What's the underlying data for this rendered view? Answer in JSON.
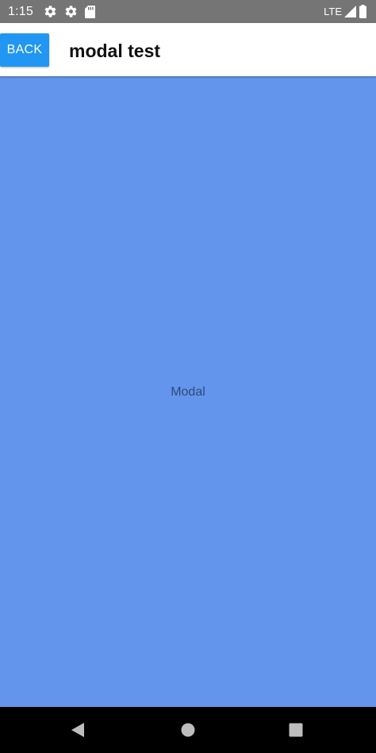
{
  "status_bar": {
    "time": "1:15",
    "network": "LTE",
    "icons": [
      "settings-icon",
      "settings-icon",
      "sd-card-icon",
      "signal-icon",
      "battery-icon"
    ]
  },
  "header": {
    "back_label": "BACK",
    "title": "modal test"
  },
  "modal": {
    "text": "Modal",
    "background": "#6495ed"
  },
  "nav_bar": {
    "icons": [
      "back-triangle-icon",
      "home-circle-icon",
      "recents-square-icon"
    ]
  },
  "colors": {
    "accent": "#2196f3",
    "status_bar": "#757575"
  }
}
